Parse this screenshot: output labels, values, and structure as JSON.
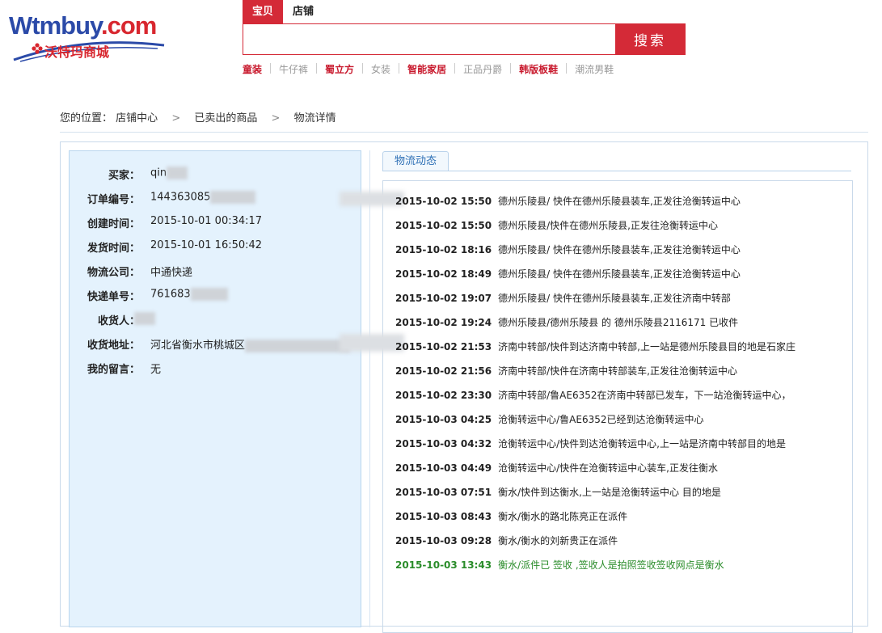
{
  "logo": {
    "brand": "Wtmbuy",
    "domain": ".com",
    "subtitle": "沃特玛商城"
  },
  "search": {
    "tabs": [
      {
        "label": "宝贝",
        "active": true
      },
      {
        "label": "店铺",
        "active": false
      }
    ],
    "value": "",
    "placeholder": "",
    "button_label": "搜索"
  },
  "hot_keywords": [
    {
      "label": "童装",
      "style": "red"
    },
    {
      "label": "牛仔裤",
      "style": "gray"
    },
    {
      "label": "蜀立方",
      "style": "red"
    },
    {
      "label": "女装",
      "style": "gray"
    },
    {
      "label": "智能家居",
      "style": "red"
    },
    {
      "label": "正品丹爵",
      "style": "gray"
    },
    {
      "label": "韩版板鞋",
      "style": "red"
    },
    {
      "label": "潮流男鞋",
      "style": "gray"
    }
  ],
  "breadcrumb": {
    "prefix": "您的位置：",
    "items": [
      "店铺中心",
      "已卖出的商品",
      "物流详情"
    ],
    "separator": ">"
  },
  "order_info": {
    "buyer_label": "买家：",
    "buyer_value": "qin",
    "order_no_label": "订单编号：",
    "order_no_value": "144363085",
    "created_label": "创建时间：",
    "created_value": "2015-10-01 00:34:17",
    "shipped_label": "发货时间：",
    "shipped_value": "2015-10-01 16:50:42",
    "carrier_label": "物流公司：",
    "carrier_value": "中通快递",
    "tracking_label": "快递单号：",
    "tracking_value": "761683",
    "receiver_label": "收货人：",
    "receiver_value": "",
    "address_label": "收货地址：",
    "address_value": "河北省衡水市桃城区",
    "note_label": "我的留言：",
    "note_value": "无"
  },
  "logistics": {
    "tab_label": "物流动态",
    "entries": [
      {
        "time": "2015-10-02 15:50",
        "text": "德州乐陵县/ 快件在德州乐陵县装车,正发往沧衡转运中心",
        "latest": false
      },
      {
        "time": "2015-10-02 15:50",
        "text": "德州乐陵县/快件在德州乐陵县,正发往沧衡转运中心",
        "latest": false
      },
      {
        "time": "2015-10-02 18:16",
        "text": "德州乐陵县/ 快件在德州乐陵县装车,正发往沧衡转运中心",
        "latest": false
      },
      {
        "time": "2015-10-02 18:49",
        "text": "德州乐陵县/ 快件在德州乐陵县装车,正发往沧衡转运中心",
        "latest": false
      },
      {
        "time": "2015-10-02 19:07",
        "text": "德州乐陵县/ 快件在德州乐陵县装车,正发往济南中转部",
        "latest": false
      },
      {
        "time": "2015-10-02 19:24",
        "text": "德州乐陵县/德州乐陵县 的 德州乐陵县2116171 已收件",
        "latest": false
      },
      {
        "time": "2015-10-02 21:53",
        "text": "济南中转部/快件到达济南中转部,上一站是德州乐陵县目的地是石家庄",
        "latest": false
      },
      {
        "time": "2015-10-02 21:56",
        "text": "济南中转部/快件在济南中转部装车,正发往沧衡转运中心",
        "latest": false
      },
      {
        "time": "2015-10-02 23:30",
        "text": "济南中转部/鲁AE6352在济南中转部已发车，下一站沧衡转运中心，",
        "latest": false
      },
      {
        "time": "2015-10-03 04:25",
        "text": "沧衡转运中心/鲁AE6352已经到达沧衡转运中心",
        "latest": false
      },
      {
        "time": "2015-10-03 04:32",
        "text": "沧衡转运中心/快件到达沧衡转运中心,上一站是济南中转部目的地是",
        "latest": false
      },
      {
        "time": "2015-10-03 04:49",
        "text": "沧衡转运中心/快件在沧衡转运中心装车,正发往衡水",
        "latest": false
      },
      {
        "time": "2015-10-03 07:51",
        "text": "衡水/快件到达衡水,上一站是沧衡转运中心 目的地是",
        "latest": false
      },
      {
        "time": "2015-10-03 08:43",
        "text": "衡水/衡水的路北陈亮正在派件",
        "latest": false
      },
      {
        "time": "2015-10-03 09:28",
        "text": "衡水/衡水的刘新贵正在派件",
        "latest": false
      },
      {
        "time": "2015-10-03 13:43",
        "text": "衡水/派件已 签收 ,签收人是拍照签收签收网点是衡水",
        "latest": true
      }
    ]
  },
  "colors": {
    "brand_red": "#d42a37",
    "brand_blue": "#2b4aa8",
    "panel_bg": "#e4f2fd",
    "signed_green": "#2a8c2a"
  }
}
